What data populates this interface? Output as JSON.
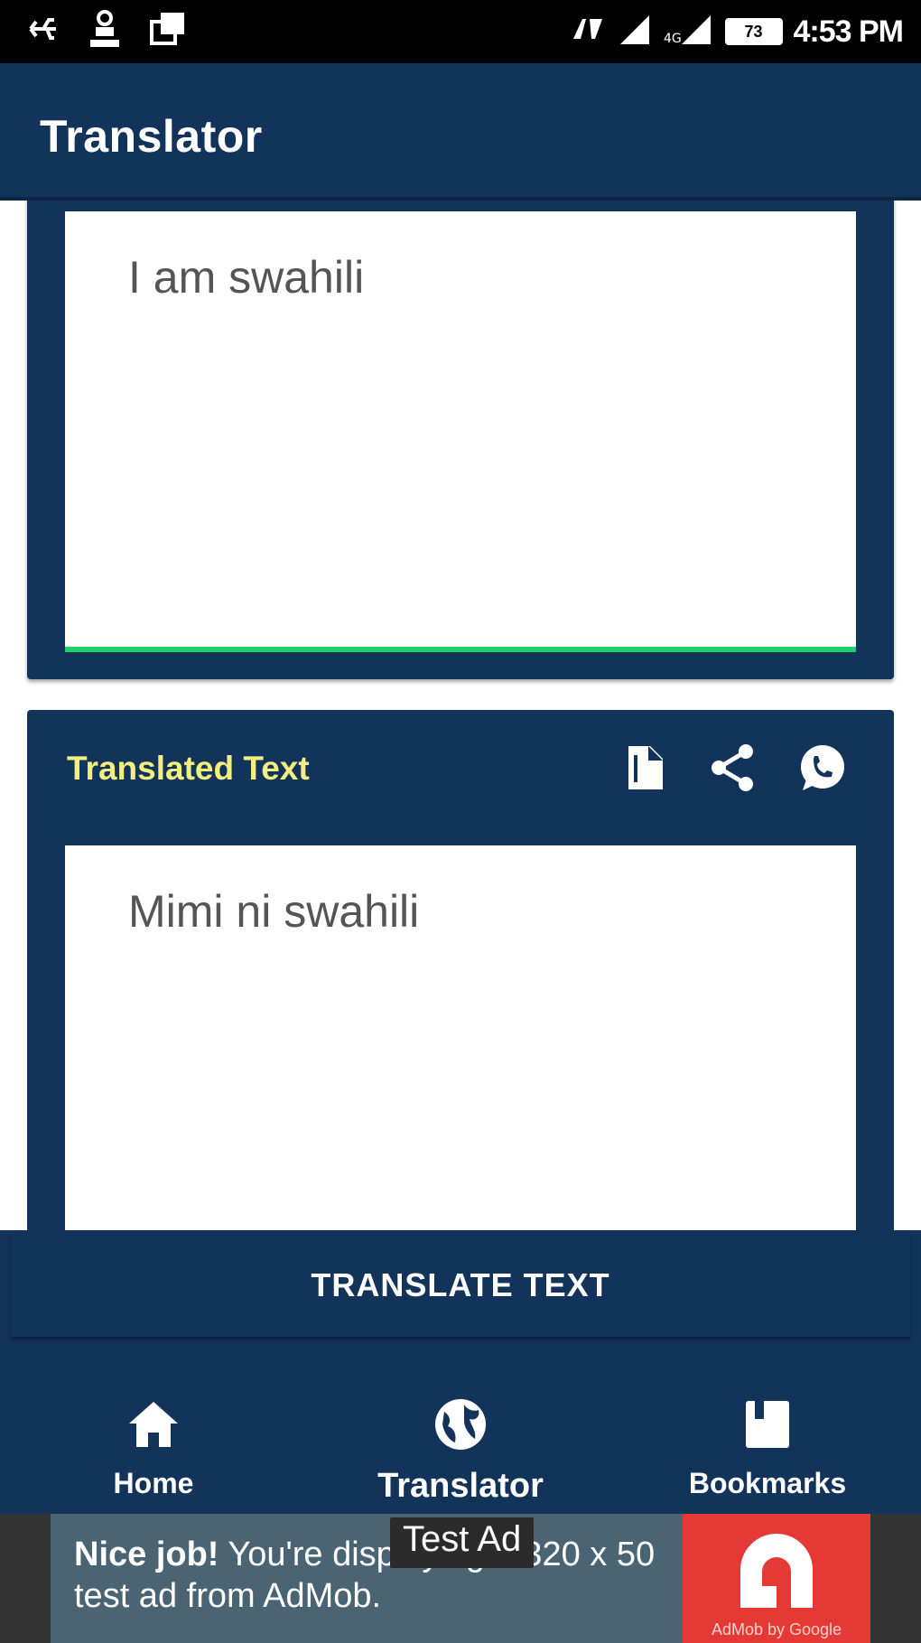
{
  "status_bar": {
    "left_icons": [
      "usb-icon",
      "notification-icon",
      "gallery-icon"
    ],
    "right_icons": [
      "wifi-calling-icon",
      "signal-icon",
      "signal-4g-icon"
    ],
    "battery": "73",
    "time": "4:53 PM"
  },
  "app_bar": {
    "title": "Translator"
  },
  "input": {
    "text": "I am swahili",
    "underline_color": "#1fd16a"
  },
  "output": {
    "label": "Translated Text",
    "text": "Mimi ni swahili",
    "actions": [
      "copy-icon",
      "share-icon",
      "whatsapp-icon"
    ]
  },
  "translate_button": {
    "label": "TRANSLATE TEXT"
  },
  "bottom_nav": {
    "items": [
      {
        "label": "Home",
        "icon": "home-icon"
      },
      {
        "label": "Translator",
        "icon": "globe-icon",
        "active": true
      },
      {
        "label": "Bookmarks",
        "icon": "bookmark-icon"
      }
    ]
  },
  "ad": {
    "title": "Nice job!",
    "message": " You're displaying a 320 x 50 test ad from AdMob.",
    "badge": "Test Ad",
    "brand": "AdMob by Google"
  },
  "colors": {
    "primary": "#12335a",
    "accent_label": "#f3ee7d",
    "ad_background": "#4b6473",
    "ad_logo": "#e53935"
  }
}
